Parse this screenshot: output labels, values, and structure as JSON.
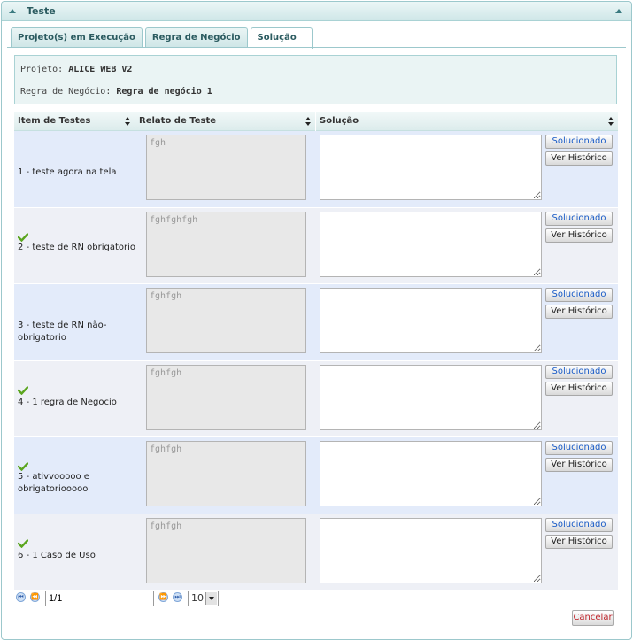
{
  "panel": {
    "title": "Teste"
  },
  "tabs": [
    {
      "label": "Projeto(s) em Execução"
    },
    {
      "label": "Regra de Negócio"
    },
    {
      "label": "Solução"
    }
  ],
  "info": {
    "projeto_label": "Projeto:",
    "projeto_value": "ALICE WEB V2",
    "regra_label": "Regra de Negócio:",
    "regra_value": "Regra de negócio 1"
  },
  "grid": {
    "headers": [
      "Item de Testes",
      "Relato de Teste",
      "Solução"
    ],
    "rows": [
      {
        "item": "1 - teste agora na tela",
        "relato": "fgh",
        "checked": false,
        "solucionado": "Solucionado",
        "historico": "Ver Histórico"
      },
      {
        "item": "2 - teste de RN obrigatorio",
        "relato": "fghfghfgh",
        "checked": true,
        "solucionado": "Solucionado",
        "historico": "Ver Histórico"
      },
      {
        "item": "3 - teste de RN não-obrigatorio",
        "relato": "fghfgh",
        "checked": false,
        "solucionado": "Solucionado",
        "historico": "Ver Histórico"
      },
      {
        "item": "4 - 1 regra de Negocio",
        "relato": "fghfgh",
        "checked": true,
        "solucionado": "Solucionado",
        "historico": "Ver Histórico"
      },
      {
        "item": "5 - ativvooooo e obrigatoriooooo",
        "relato": "fghfgh",
        "checked": true,
        "solucionado": "Solucionado",
        "historico": "Ver Histórico"
      },
      {
        "item": "6 - 1 Caso de Uso",
        "relato": "fghfgh",
        "checked": true,
        "solucionado": "Solucionado",
        "historico": "Ver Histórico"
      }
    ]
  },
  "pager": {
    "page": "1/1",
    "page_size": "10"
  },
  "actions": {
    "cancel": "Cancelar"
  },
  "colors": {
    "accent": "#9cc8cc",
    "row_odd": "#e3ebfa",
    "row_even": "#eef0f6",
    "link_blue": "#1a5cc7",
    "cancel_red": "#c0262d",
    "check_green": "#5aa51e"
  }
}
